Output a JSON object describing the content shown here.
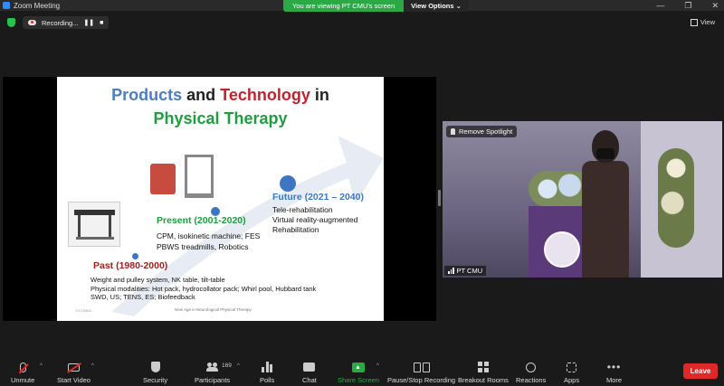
{
  "window": {
    "title": "Zoom Meeting",
    "controls": [
      "—",
      "❐",
      "✕"
    ]
  },
  "banner": {
    "viewing_text": "You are viewing PT CMU's screen",
    "view_options_label": "View Options ⌄"
  },
  "top": {
    "recording_label": "Recording...",
    "pause_symbol": "❚❚",
    "stop_symbol": "■",
    "view_label": "View"
  },
  "slide": {
    "title_line1_part1": "Products",
    "title_line1_part2": " and ",
    "title_line1_part3": "Technology",
    "title_line1_part4": " in",
    "title_line2": "Physical Therapy",
    "future_heading": "Future (2021 – 2040)",
    "future_items": [
      "Tele-rehabilitation",
      "Virtual reality-augmented",
      "Rehabilitation"
    ],
    "present_heading": "Present (2001-2020)",
    "present_items": [
      "CPM, isokinetic machine; FES",
      "PBWS treadmills, Robotics"
    ],
    "past_heading": "Past (1980-2000)",
    "past_items": [
      "Weight and pulley system, NK table,  tilt-table",
      "Physical modalities: Hot pack, hydrocollator pack; Whirl pool, Hubbard tank",
      "SWD, US; TENS, ES; Biofeedback"
    ],
    "footer_text": "New Age in Neurological Physical Therapy",
    "slide_number": "7/17/2563",
    "colors": {
      "blue": "#4a7ec0",
      "red": "#c0232b",
      "green": "#1e9e3f",
      "past_red": "#a12020"
    }
  },
  "video_tile": {
    "remove_spotlight_label": "Remove Spotlight",
    "participant_name": "PT CMU"
  },
  "toolbar": {
    "unmute": "Unmute",
    "start_video": "Start Video",
    "security": "Security",
    "participants": "Participants",
    "participants_count": "169",
    "polls": "Polls",
    "chat": "Chat",
    "share_screen": "Share Screen",
    "pause_stop_recording": "Pause/Stop Recording",
    "breakout_rooms": "Breakout Rooms",
    "reactions": "Reactions",
    "apps": "Apps",
    "more": "More",
    "leave": "Leave",
    "caret": "^",
    "share_color": "#2aa945",
    "leave_color": "#e02828"
  }
}
